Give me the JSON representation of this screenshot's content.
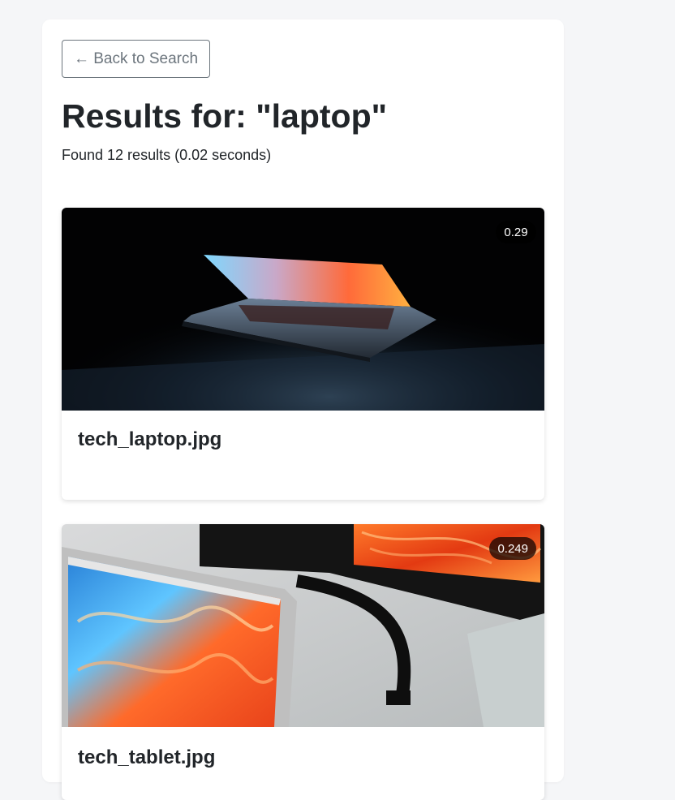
{
  "back_button": {
    "label": "← Back to Search"
  },
  "header": {
    "title": "Results for: \"laptop\"",
    "summary": "Found 12 results (0.02 seconds)"
  },
  "results": [
    {
      "filename": "tech_laptop.jpg",
      "score": "0.29",
      "image": "laptop-dark-photo"
    },
    {
      "filename": "tech_tablet.jpg",
      "score": "0.249",
      "image": "laptop-monitor-photo"
    }
  ],
  "colors": {
    "page_background": "#f5f6f8",
    "panel_background": "#ffffff",
    "button_border": "#6c757d",
    "text": "#212529"
  }
}
